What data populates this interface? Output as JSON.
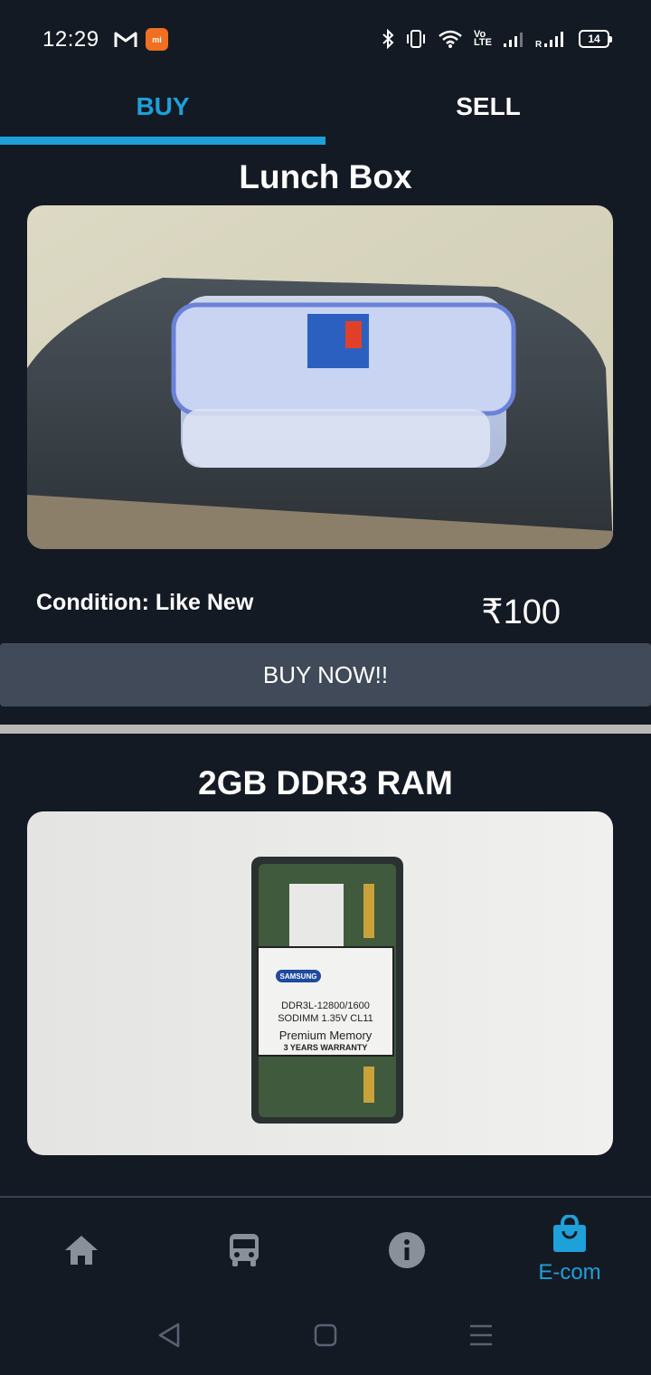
{
  "status_bar": {
    "time": "12:29",
    "volte": "Vo\nLTE",
    "battery": "14",
    "icons": [
      "gmail-icon",
      "mi-app-icon",
      "bluetooth-icon",
      "vibrate-icon",
      "wifi-icon",
      "signal-icon",
      "roaming-signal-icon",
      "battery-icon"
    ]
  },
  "tabs": [
    {
      "label": "BUY",
      "active": true
    },
    {
      "label": "SELL",
      "active": false
    }
  ],
  "products": [
    {
      "title": "Lunch Box",
      "condition": "Condition: Like New",
      "price": "₹100",
      "button": "BUY NOW!!"
    },
    {
      "title": "2GB DDR3 RAM",
      "label_brand": "SAMSUNG",
      "label_line1": "DDR3L-12800/1600",
      "label_line2": "SODIMM 1.35V CL11",
      "label_line3": "Premium Memory",
      "label_line4": "3 YEARS WARRANTY"
    }
  ],
  "bottom_nav": [
    {
      "icon": "home-icon",
      "label": ""
    },
    {
      "icon": "bus-icon",
      "label": ""
    },
    {
      "icon": "info-icon",
      "label": ""
    },
    {
      "icon": "shopping-bag-icon",
      "label": "E-com",
      "active": true
    }
  ],
  "colors": {
    "background": "#141a24",
    "accent": "#1ea0d8",
    "button": "#404a58",
    "inactive_icon": "#8a9099"
  }
}
